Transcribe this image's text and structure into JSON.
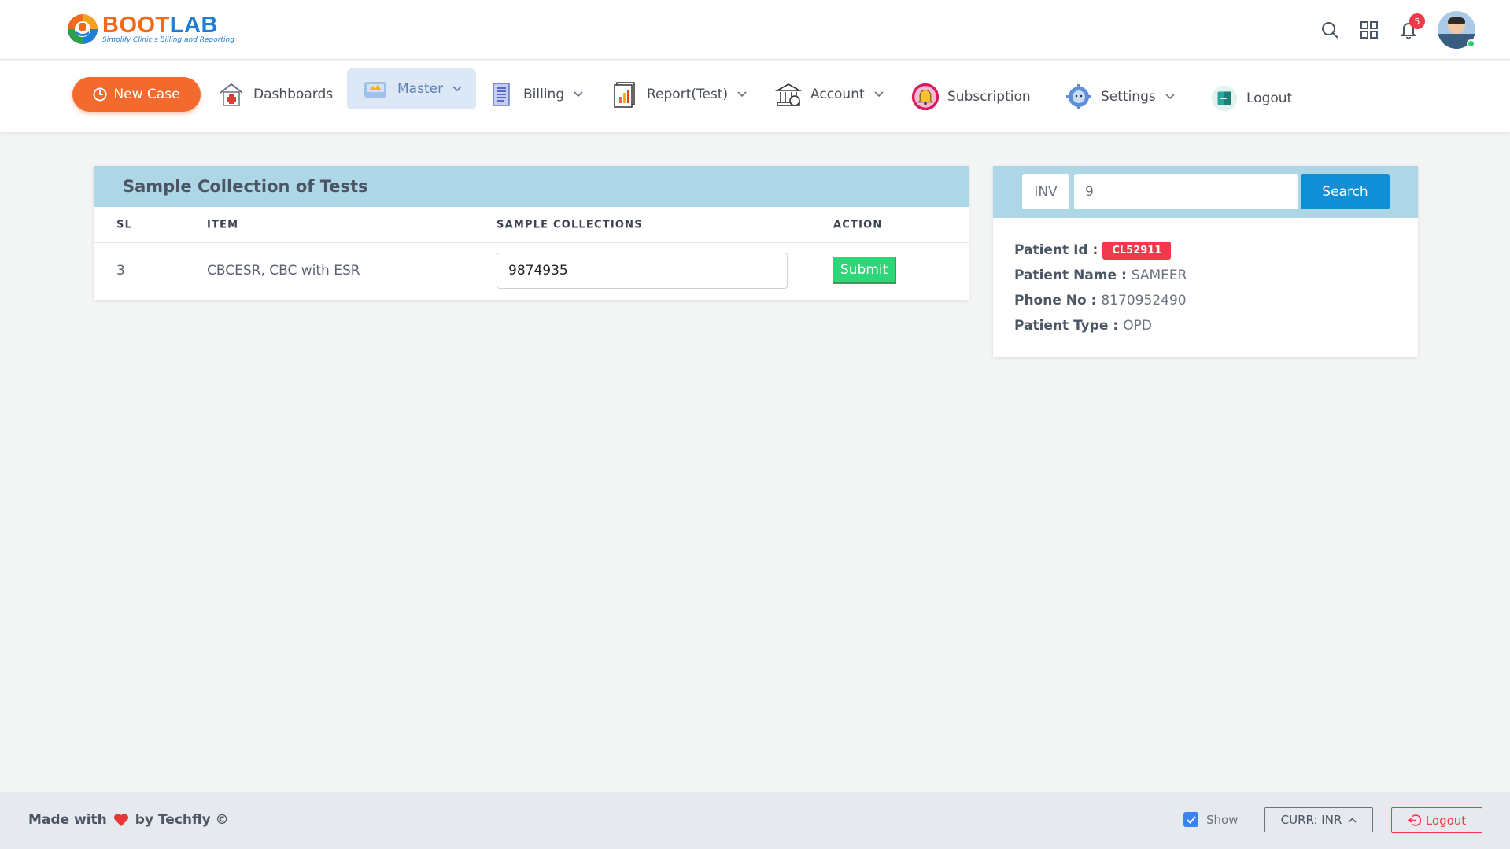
{
  "brand": {
    "name_part1": "BOOT",
    "name_part2": "LAB",
    "tagline": "Simplify Clinic's Billing and Reporting"
  },
  "header": {
    "notification_count": "5",
    "icons": [
      "search-icon",
      "grid-icon",
      "bell-icon",
      "avatar"
    ]
  },
  "nav": {
    "new_case": "New Case",
    "items": [
      {
        "label": "Dashboards",
        "icon": "hospital-icon",
        "dropdown": false
      },
      {
        "label": "Master",
        "icon": "master-icon",
        "dropdown": true,
        "active": true
      },
      {
        "label": "Billing",
        "icon": "billing-icon",
        "dropdown": true
      },
      {
        "label": "Report(Test)",
        "icon": "report-icon",
        "dropdown": true
      },
      {
        "label": "Account",
        "icon": "bank-icon",
        "dropdown": true
      },
      {
        "label": "Subscription",
        "icon": "bell-badge-icon",
        "dropdown": false
      },
      {
        "label": "Settings",
        "icon": "gear-icon",
        "dropdown": true
      },
      {
        "label": "Logout",
        "icon": "logout-icon",
        "dropdown": false
      }
    ]
  },
  "sample_card": {
    "title": "Sample Collection of Tests",
    "columns": [
      "SL",
      "ITEM",
      "SAMPLE COLLECTIONS",
      "ACTION"
    ],
    "rows": [
      {
        "sl": "3",
        "item": "CBCESR, CBC with ESR",
        "sample": "9874935",
        "action": "Submit"
      }
    ]
  },
  "search_card": {
    "prefix": "INV",
    "value": "9",
    "button": "Search",
    "patient": {
      "id_label": "Patient Id :",
      "id": "CL52911",
      "name_label": "Patient Name :",
      "name": "SAMEER",
      "phone_label": "Phone No :",
      "phone": "8170952490",
      "type_label": "Patient Type :",
      "type": "OPD"
    }
  },
  "footer": {
    "made_with": "Made with",
    "by": "by Techfly ©",
    "show_label": "Show",
    "currency": "CURR: INR",
    "logout": "Logout"
  },
  "colors": {
    "accent_orange": "#f26a2e",
    "card_header": "#add6e6",
    "search_button": "#0e8fd6",
    "submit_green": "#2ed67a",
    "badge_red": "#f0394b"
  }
}
